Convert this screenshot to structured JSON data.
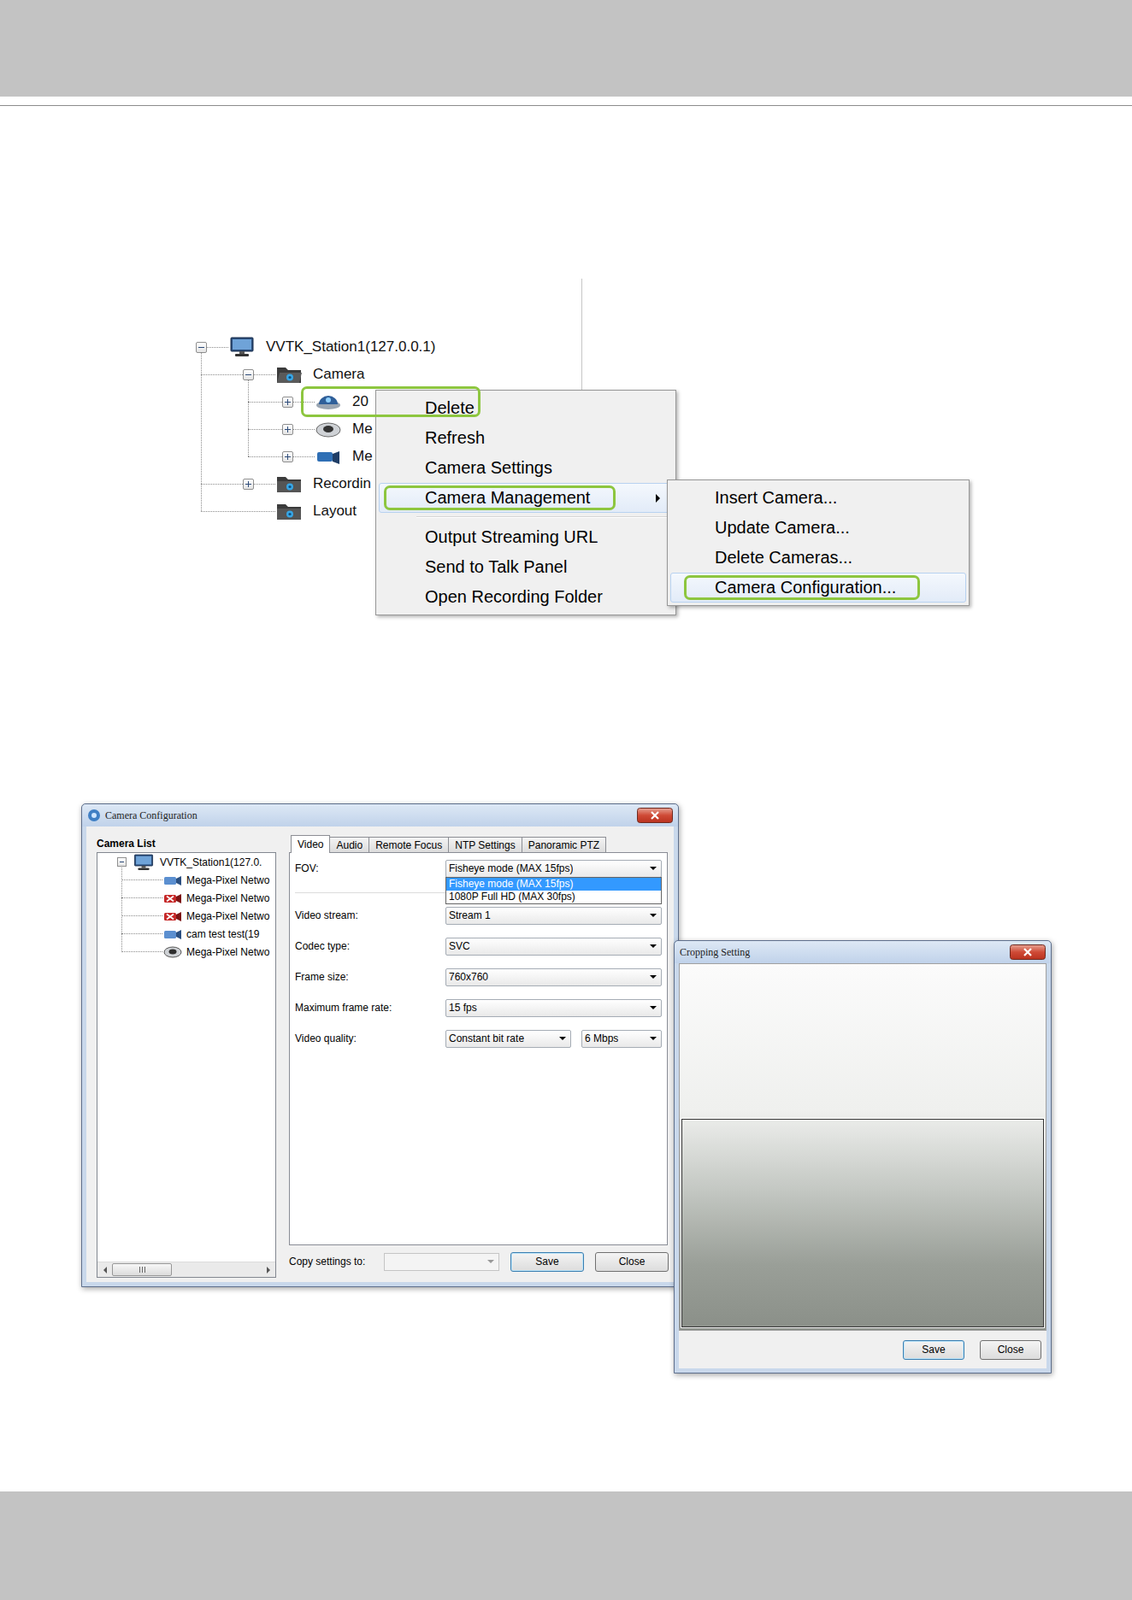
{
  "tree": {
    "root": {
      "label": "VVTK_Station1(127.0.0.1)",
      "expanded": true
    },
    "folders": [
      {
        "label": "Camera",
        "expandable": true,
        "expanded": true,
        "cameras": [
          {
            "label": "20",
            "kind": "dome",
            "expanded": false,
            "highlighted": true
          },
          {
            "label": "Me",
            "kind": "fisheye",
            "expanded": false,
            "highlighted": false
          },
          {
            "label": "Me",
            "kind": "box",
            "expanded": false,
            "highlighted": false
          }
        ]
      },
      {
        "label": "Recordin",
        "expandable": true,
        "expanded": false,
        "cameras": []
      },
      {
        "label": "Layout",
        "expandable": false,
        "expanded": false,
        "cameras": []
      }
    ]
  },
  "context_menu": {
    "items": [
      {
        "label": "Delete",
        "separator_before": false,
        "has_submenu": false,
        "hovered": false,
        "highlighted": false
      },
      {
        "label": "Refresh",
        "separator_before": false,
        "has_submenu": false,
        "hovered": false,
        "highlighted": false
      },
      {
        "label": "Camera Settings",
        "separator_before": false,
        "has_submenu": false,
        "hovered": false,
        "highlighted": false
      },
      {
        "label": "Camera Management",
        "separator_before": false,
        "has_submenu": true,
        "hovered": true,
        "highlighted": true
      },
      {
        "label": "Output Streaming URL",
        "separator_before": true,
        "has_submenu": false,
        "hovered": false,
        "highlighted": false
      },
      {
        "label": "Send to Talk Panel",
        "separator_before": false,
        "has_submenu": false,
        "hovered": false,
        "highlighted": false
      },
      {
        "label": "Open Recording Folder",
        "separator_before": false,
        "has_submenu": false,
        "hovered": false,
        "highlighted": false
      }
    ]
  },
  "submenu": {
    "items": [
      {
        "label": "Insert Camera...",
        "hovered": false,
        "highlighted": false
      },
      {
        "label": "Update Camera...",
        "hovered": false,
        "highlighted": false
      },
      {
        "label": "Delete Cameras...",
        "hovered": false,
        "highlighted": false
      },
      {
        "label": "Camera Configuration...",
        "hovered": true,
        "highlighted": true
      }
    ]
  },
  "camera_configuration": {
    "title": "Camera Configuration",
    "list_title": "Camera List",
    "root": {
      "label": "VVTK_Station1(127.0.",
      "expanded": true
    },
    "cameras": [
      {
        "label": "Mega-Pixel Netwo",
        "kind": "box",
        "connected": true
      },
      {
        "label": "Mega-Pixel Netwo",
        "kind": "box",
        "connected": false
      },
      {
        "label": "Mega-Pixel Netwo",
        "kind": "box",
        "connected": false
      },
      {
        "label": "cam test test(19",
        "kind": "box",
        "connected": true
      },
      {
        "label": "Mega-Pixel Netwo",
        "kind": "fisheye",
        "connected": true
      }
    ],
    "tabs": [
      {
        "label": "Video",
        "selected": true
      },
      {
        "label": "Audio",
        "selected": false
      },
      {
        "label": "Remote Focus",
        "selected": false
      },
      {
        "label": "NTP Settings",
        "selected": false
      },
      {
        "label": "Panoramic PTZ",
        "selected": false
      }
    ],
    "fields": [
      {
        "label": "FOV:",
        "values": [
          "Fisheye mode (MAX 15fps)"
        ],
        "open": true,
        "options": [
          {
            "label": "Fisheye mode (MAX 15fps)",
            "selected": true
          },
          {
            "label": "1080P Full HD (MAX 30fps)",
            "selected": false
          }
        ]
      },
      {
        "label": "Video stream:",
        "values": [
          "Stream 1"
        ],
        "open": false,
        "options": []
      },
      {
        "label": "Codec type:",
        "values": [
          "SVC"
        ],
        "open": false,
        "options": []
      },
      {
        "label": "Frame size:",
        "values": [
          "760x760"
        ],
        "open": false,
        "options": []
      },
      {
        "label": "Maximum frame rate:",
        "values": [
          "15 fps"
        ],
        "open": false,
        "options": []
      },
      {
        "label": "Video quality:",
        "values": [
          "Constant bit rate",
          "6 Mbps"
        ],
        "open": false,
        "options": []
      }
    ],
    "copy_settings": {
      "label": "Copy settings to:",
      "value": "",
      "disabled": true
    },
    "buttons": [
      {
        "label": "Save",
        "default": true
      },
      {
        "label": "Close",
        "default": false
      }
    ]
  },
  "cropping_setting": {
    "title": "Cropping Setting",
    "buttons": [
      {
        "label": "Save",
        "default": true
      },
      {
        "label": "Close",
        "default": false
      }
    ]
  }
}
